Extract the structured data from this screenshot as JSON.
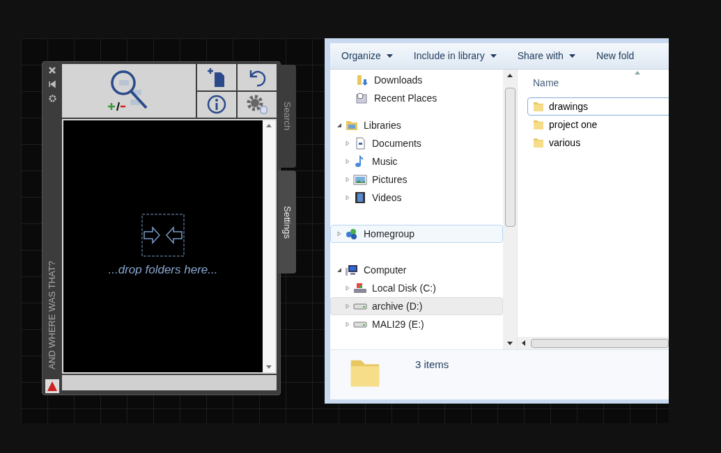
{
  "palette": {
    "title": "AND WHERE WAS THAT?",
    "drop_hint": "...drop folders here...",
    "tabs": [
      {
        "label": "Search",
        "selected": false
      },
      {
        "label": "Settings",
        "selected": true
      }
    ]
  },
  "explorer": {
    "toolbar": [
      {
        "label": "Organize",
        "dropdown": true
      },
      {
        "label": "Include in library",
        "dropdown": true
      },
      {
        "label": "Share with",
        "dropdown": true
      },
      {
        "label": "New fold",
        "dropdown": false
      }
    ],
    "favorites": [
      {
        "label": "Downloads",
        "kind": "downloads"
      },
      {
        "label": "Recent Places",
        "kind": "recent"
      }
    ],
    "tree": [
      {
        "label": "Libraries",
        "kind": "libraries",
        "expanded": true,
        "hovered": false,
        "selected": false,
        "children": [
          {
            "label": "Documents",
            "kind": "documents",
            "expanded": false,
            "hovered": false,
            "selected": false
          },
          {
            "label": "Music",
            "kind": "music",
            "expanded": false,
            "hovered": false,
            "selected": false
          },
          {
            "label": "Pictures",
            "kind": "pictures",
            "expanded": false,
            "hovered": false,
            "selected": false
          },
          {
            "label": "Videos",
            "kind": "videos",
            "expanded": false,
            "hovered": false,
            "selected": false
          }
        ]
      },
      {
        "label": "Homegroup",
        "kind": "homegroup",
        "expanded": false,
        "hovered": true,
        "selected": false
      },
      {
        "label": "Computer",
        "kind": "computer",
        "expanded": true,
        "hovered": false,
        "selected": false,
        "children": [
          {
            "label": "Local Disk (C:)",
            "kind": "system-drive",
            "expanded": false,
            "hovered": false,
            "selected": false
          },
          {
            "label": "archive (D:)",
            "kind": "drive",
            "expanded": false,
            "hovered": false,
            "selected": true
          },
          {
            "label": "MALI29 (E:)",
            "kind": "drive",
            "expanded": false,
            "hovered": false,
            "selected": false
          }
        ]
      }
    ],
    "column": "Name",
    "files": [
      {
        "name": "drawings",
        "selected": true
      },
      {
        "name": "project one",
        "selected": false
      },
      {
        "name": "various",
        "selected": false
      }
    ],
    "status": "3 items"
  }
}
